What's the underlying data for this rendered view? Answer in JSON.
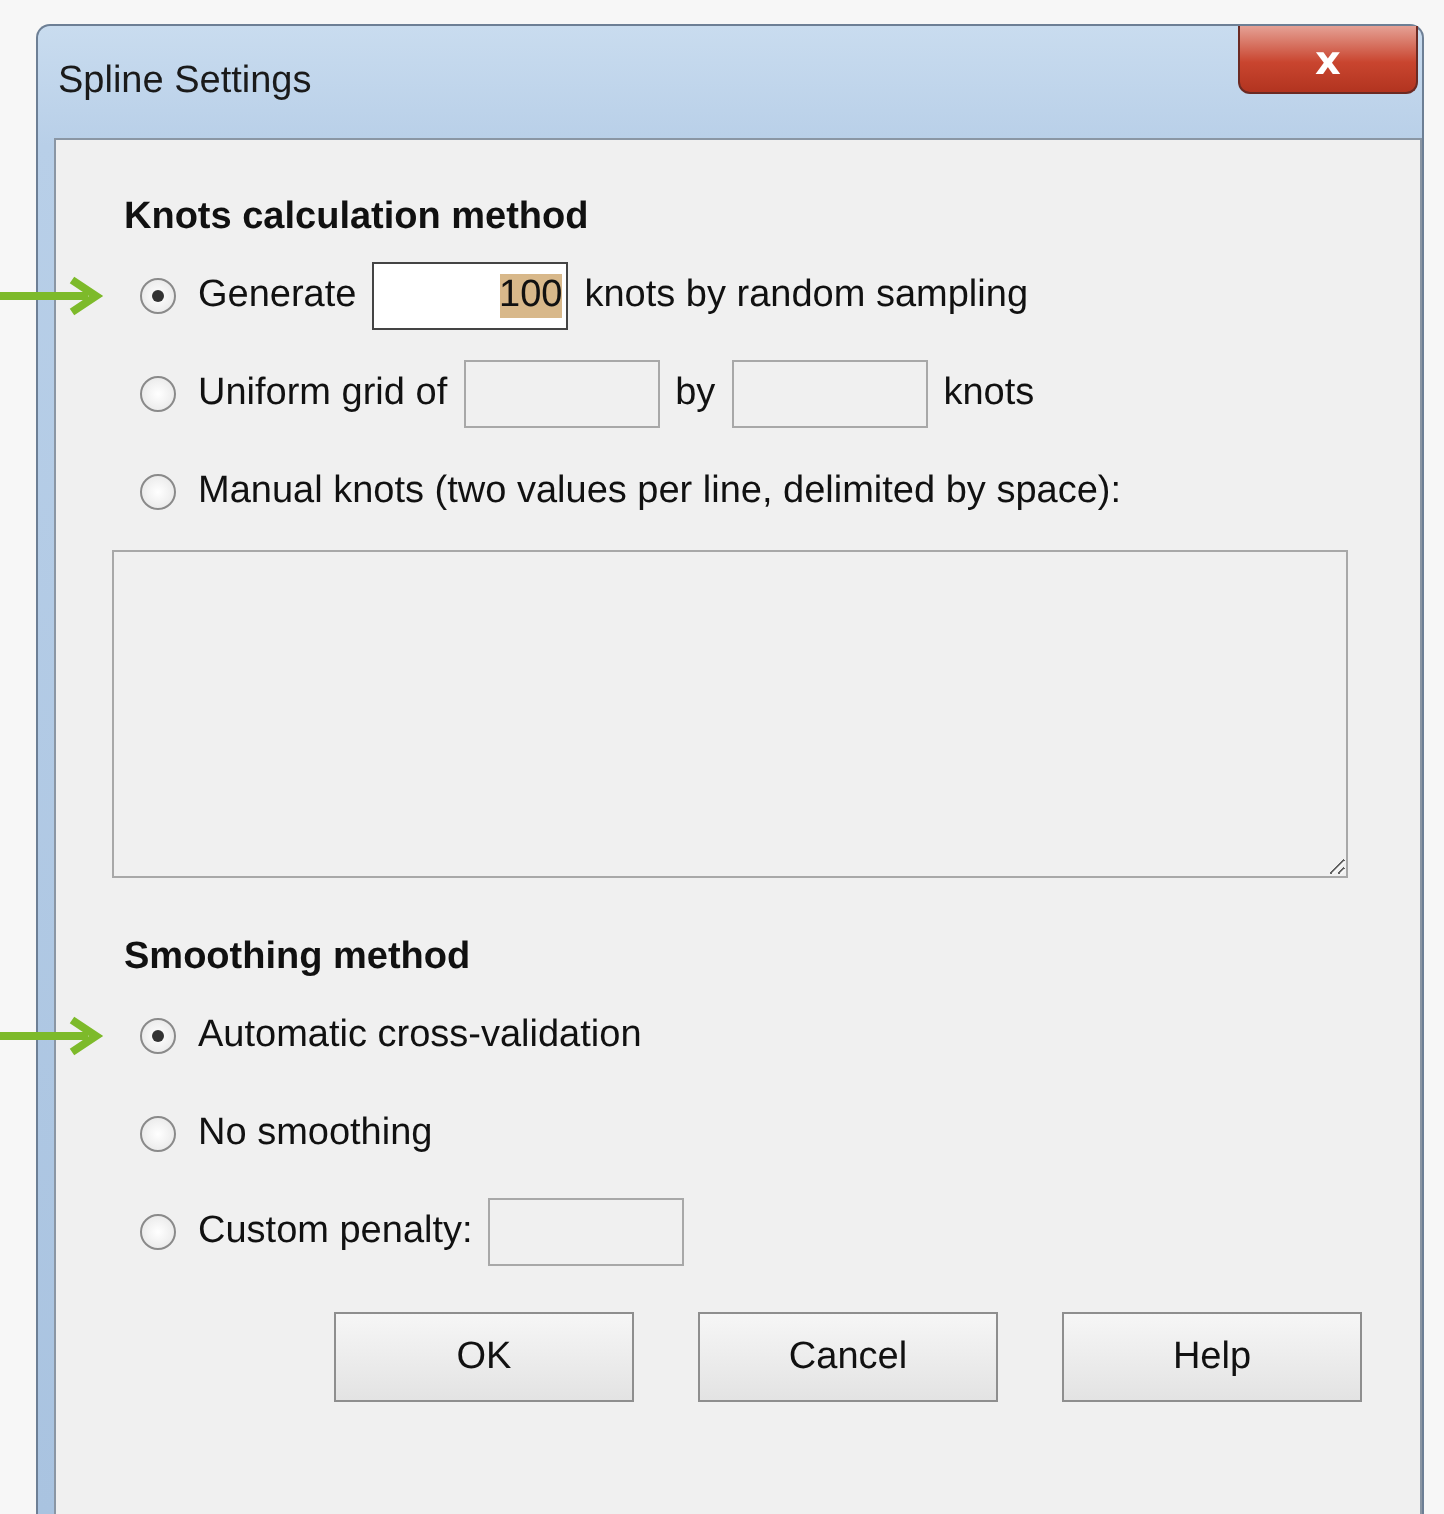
{
  "window": {
    "title": "Spline Settings",
    "close_label": "x"
  },
  "sections": [
    {
      "heading": "Knots calculation method",
      "options": [
        {
          "selected": true,
          "marked": true,
          "parts": [
            {
              "kind": "text",
              "text": "Generate"
            },
            {
              "kind": "field",
              "value": "100",
              "highlighted": true
            },
            {
              "kind": "text",
              "text": "knots by random sampling"
            }
          ]
        },
        {
          "selected": false,
          "marked": false,
          "parts": [
            {
              "kind": "text",
              "text": "Uniform grid of"
            },
            {
              "kind": "field"
            },
            {
              "kind": "text",
              "text": "by"
            },
            {
              "kind": "field"
            },
            {
              "kind": "text",
              "text": "knots"
            }
          ]
        },
        {
          "selected": false,
          "marked": false,
          "parts": [
            {
              "kind": "text",
              "text": "Manual knots (two values per line, delimited by space):"
            }
          ]
        }
      ],
      "text_area": {
        "kind": "empty"
      }
    },
    {
      "heading": "Smoothing method",
      "options": [
        {
          "selected": true,
          "marked": true,
          "parts": [
            {
              "kind": "text",
              "text": "Automatic cross-validation"
            }
          ]
        },
        {
          "selected": false,
          "marked": false,
          "parts": [
            {
              "kind": "text",
              "text": "No smoothing"
            }
          ]
        },
        {
          "selected": false,
          "marked": false,
          "parts": [
            {
              "kind": "text",
              "text": "Custom penalty:"
            },
            {
              "kind": "field"
            }
          ]
        }
      ]
    }
  ],
  "buttons": [
    "OK",
    "Cancel",
    "Help"
  ]
}
